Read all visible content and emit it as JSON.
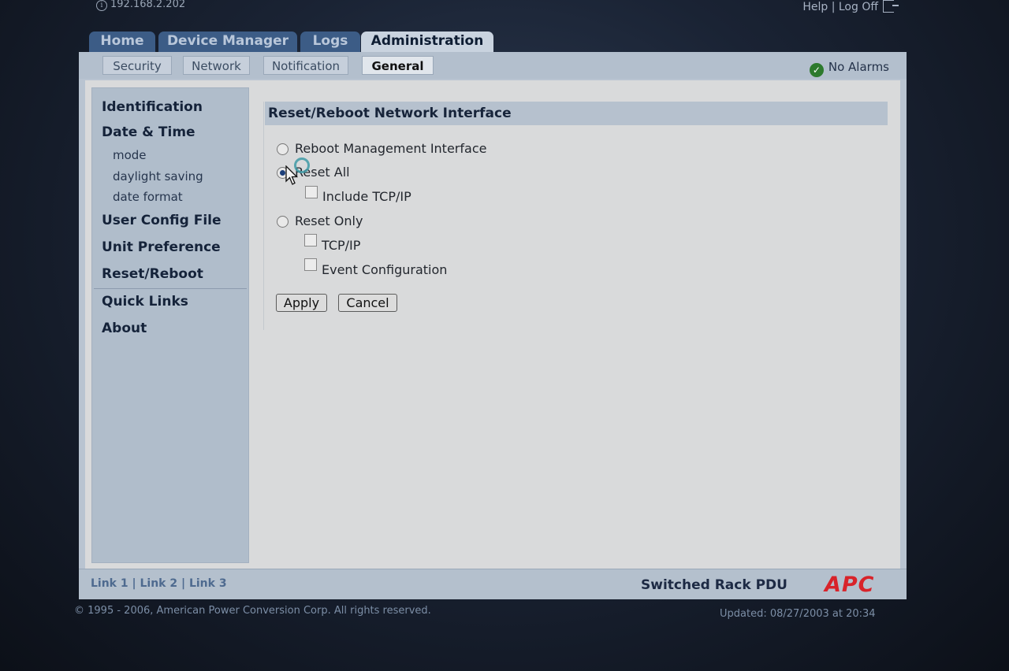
{
  "header": {
    "ip_address": "192.168.2.202",
    "help_label": "Help",
    "separator": "|",
    "logoff_label": "Log Off"
  },
  "tabs": [
    {
      "label": "Home"
    },
    {
      "label": "Device Manager"
    },
    {
      "label": "Logs"
    },
    {
      "label": "Administration",
      "active": true
    }
  ],
  "subtabs": [
    {
      "label": "Security"
    },
    {
      "label": "Network"
    },
    {
      "label": "Notification"
    },
    {
      "label": "General",
      "active": true
    }
  ],
  "status": {
    "label": "No Alarms",
    "icon": "checkmark-icon",
    "color": "#2d7a2d"
  },
  "sidebar": {
    "items": [
      {
        "label": "Identification"
      },
      {
        "label": "Date & Time"
      },
      {
        "label": "mode"
      },
      {
        "label": "daylight saving"
      },
      {
        "label": "date format"
      },
      {
        "label": "User Config File"
      },
      {
        "label": "Unit Preference"
      },
      {
        "label": "Reset/Reboot"
      },
      {
        "label": "Quick Links"
      },
      {
        "label": "About"
      }
    ]
  },
  "main": {
    "title": "Reset/Reboot Network Interface",
    "options": {
      "reboot_management": "Reboot Management Interface",
      "reset_all": "Reset All",
      "include_tcpip": "Include TCP/IP",
      "reset_only": "Reset Only",
      "tcpip": "TCP/IP",
      "event_configuration": "Event Configuration"
    },
    "selected_option": "reset_all",
    "apply_label": "Apply",
    "cancel_label": "Cancel"
  },
  "footer": {
    "links": "Link 1 | Link 2 | Link 3",
    "product": "Switched Rack PDU",
    "brand": "APC",
    "brand_color": "#d8232a",
    "copyright": "© 1995 - 2006, American Power Conversion Corp. All rights reserved.",
    "updated": "Updated: 08/27/2003 at 20:34"
  }
}
